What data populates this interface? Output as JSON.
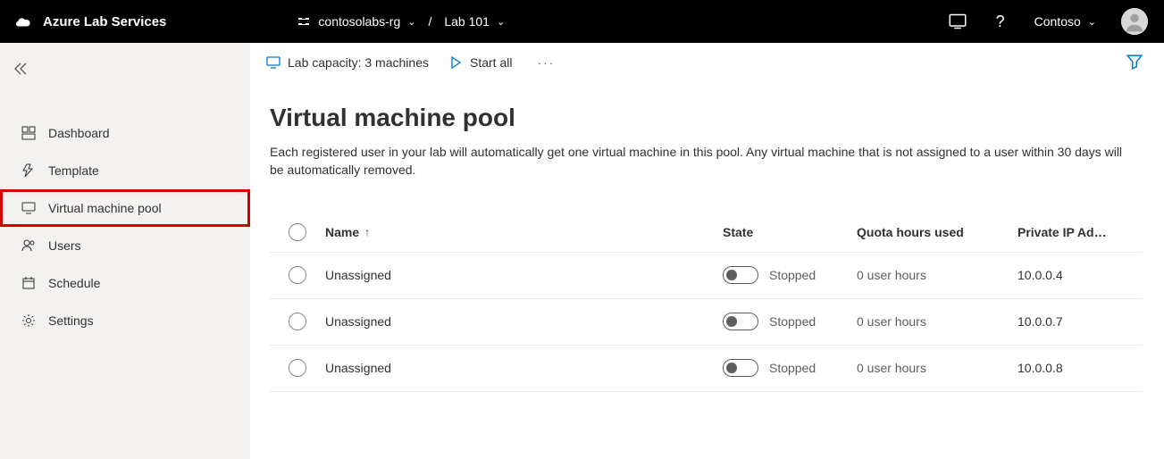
{
  "brand": "Azure Lab Services",
  "breadcrumb": {
    "resourceGroup": "contosolabs-rg",
    "lab": "Lab 101",
    "separator": "/"
  },
  "user": "Contoso",
  "sidebar": {
    "items": [
      {
        "label": "Dashboard"
      },
      {
        "label": "Template"
      },
      {
        "label": "Virtual machine pool"
      },
      {
        "label": "Users"
      },
      {
        "label": "Schedule"
      },
      {
        "label": "Settings"
      }
    ]
  },
  "commandBar": {
    "capacity": "Lab capacity: 3 machines",
    "startAll": "Start all"
  },
  "page": {
    "title": "Virtual machine pool",
    "description": "Each registered user in your lab will automatically get one virtual machine in this pool. Any virtual machine that is not assigned to a user within 30 days will be automatically removed."
  },
  "columns": {
    "name": "Name",
    "state": "State",
    "quota": "Quota hours used",
    "ip": "Private IP Ad…"
  },
  "rows": [
    {
      "name": "Unassigned",
      "state": "Stopped",
      "quota": "0 user hours",
      "ip": "10.0.0.4"
    },
    {
      "name": "Unassigned",
      "state": "Stopped",
      "quota": "0 user hours",
      "ip": "10.0.0.7"
    },
    {
      "name": "Unassigned",
      "state": "Stopped",
      "quota": "0 user hours",
      "ip": "10.0.0.8"
    }
  ]
}
